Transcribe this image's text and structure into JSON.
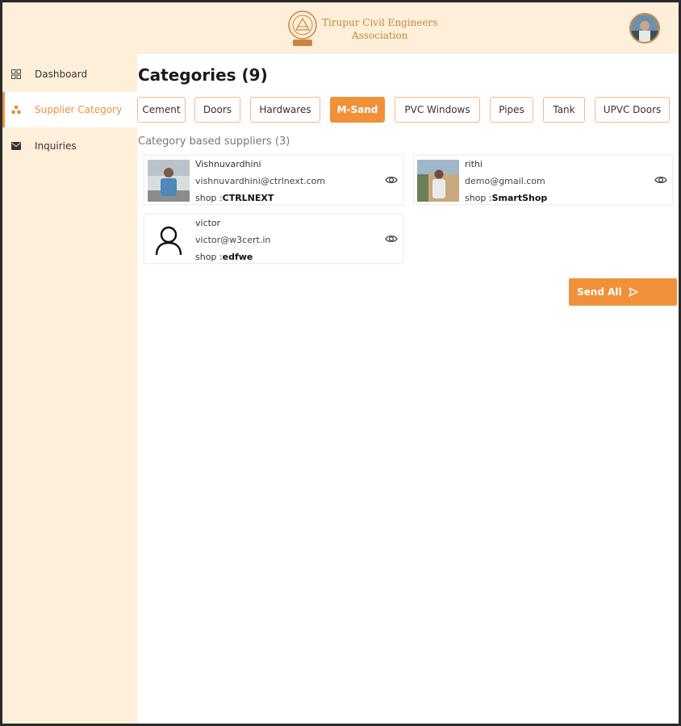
{
  "header": {
    "org_name_line1": "Tirupur Civil Engineers",
    "org_name_line2": "Association"
  },
  "sidebar": {
    "items": [
      {
        "label": "Dashboard",
        "icon": "grid-icon",
        "active": false
      },
      {
        "label": "Supplier Category",
        "icon": "nodes-icon",
        "active": true
      },
      {
        "label": "Inquiries",
        "icon": "mail-icon",
        "active": false
      }
    ]
  },
  "main": {
    "title": "Categories (9)",
    "tabs": [
      {
        "label": "Cement"
      },
      {
        "label": "Doors"
      },
      {
        "label": "Hardwares"
      },
      {
        "label": "M-Sand",
        "active": true
      },
      {
        "label": "PVC Windows"
      },
      {
        "label": "Pipes"
      },
      {
        "label": "Tank"
      },
      {
        "label": "UPVC Doors"
      }
    ],
    "subheading": "Category based suppliers (3)",
    "suppliers": [
      {
        "name": "Vishnuvardhini",
        "email": "vishnuvardhini@ctrlnext.com",
        "shop_prefix": "shop :",
        "shop": "CTRLNEXT",
        "avatar": "photo"
      },
      {
        "name": "rithi",
        "email": "demo@gmail.com",
        "shop_prefix": "shop :",
        "shop": "SmartShop",
        "avatar": "photo"
      },
      {
        "name": "victor",
        "email": "victor@w3cert.in",
        "shop_prefix": "shop :",
        "shop": "edfwe",
        "avatar": "person-outline-icon"
      }
    ],
    "send_all_label": "Send All"
  },
  "colors": {
    "accent": "#f0913a",
    "sidebar_bg": "#fdefd9",
    "tab_border": "#f3b98a"
  }
}
